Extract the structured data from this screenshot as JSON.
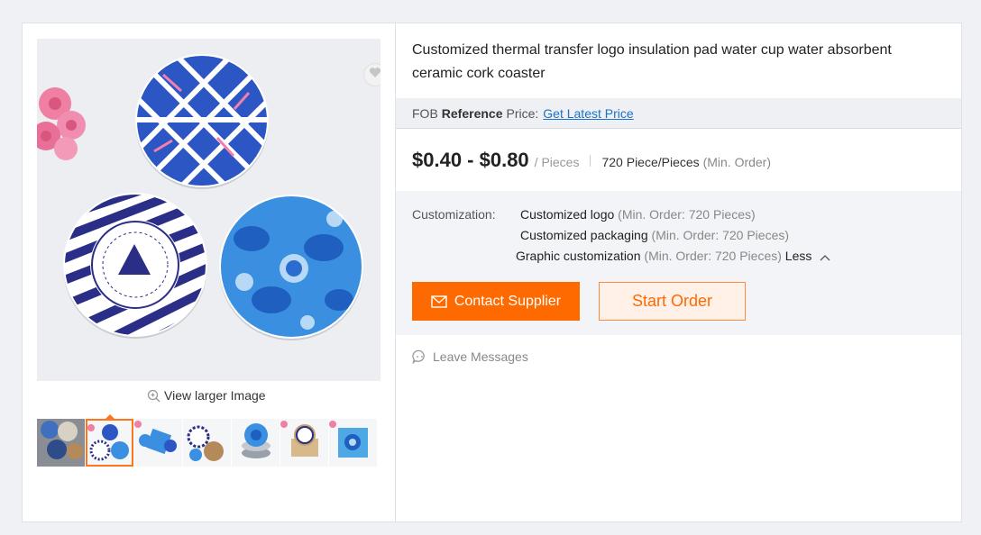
{
  "gallery": {
    "view_larger": "View larger Image",
    "icons": {
      "favorite": "heart-icon",
      "zoom": "zoom-in-icon"
    },
    "thumbnails": [
      "thumbnail-1",
      "thumbnail-2",
      "thumbnail-3",
      "thumbnail-4",
      "thumbnail-5",
      "thumbnail-6",
      "thumbnail-7"
    ],
    "active_thumbnail": 2
  },
  "product": {
    "title": "Customized thermal transfer logo insulation pad water cup water absorbent ceramic cork coaster"
  },
  "fob": {
    "prefix": "FOB",
    "bold": "Reference",
    "suffix": "Price:",
    "link": "Get Latest Price"
  },
  "pricing": {
    "range": "$0.40 - $0.80",
    "unit": "/ Pieces",
    "moq_value": "720 Piece/Pieces",
    "moq_label": "(Min. Order)"
  },
  "customization": {
    "label": "Customization:",
    "options": [
      {
        "name": "Customized logo",
        "moq": "(Min. Order: 720 Pieces)"
      },
      {
        "name": "Customized packaging",
        "moq": "(Min. Order: 720 Pieces)"
      },
      {
        "name": "Graphic customization",
        "moq": "(Min. Order: 720 Pieces)"
      }
    ],
    "toggle": "Less"
  },
  "actions": {
    "contact": "Contact Supplier",
    "start_order": "Start Order",
    "leave_messages": "Leave Messages"
  },
  "colors": {
    "accent": "#ff6a00",
    "link": "#1a73c8",
    "page_bg": "#eff1f5"
  }
}
